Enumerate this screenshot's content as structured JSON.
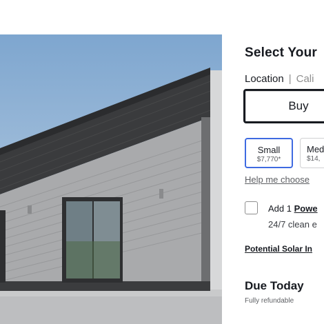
{
  "panel": {
    "title": "Select Your",
    "location_label": "Location",
    "location_separator": "|",
    "location_value": "Cali",
    "buy_button": "Buy",
    "size_options": [
      {
        "name": "Small",
        "price": "$7,770*",
        "selected": true
      },
      {
        "name": "Med",
        "price": "$14,",
        "selected": false
      }
    ],
    "help_link": "Help me choose",
    "addon": {
      "checked": false,
      "prefix": "Add 1",
      "product": "Powe",
      "description": "24/7 clean e"
    },
    "potential_link": "Potential Solar In",
    "due_title": "Due Today",
    "due_note": "Fully refundable"
  },
  "colors": {
    "accent": "#3e6ae1",
    "text": "#171a20",
    "muted": "#5c5e62"
  }
}
